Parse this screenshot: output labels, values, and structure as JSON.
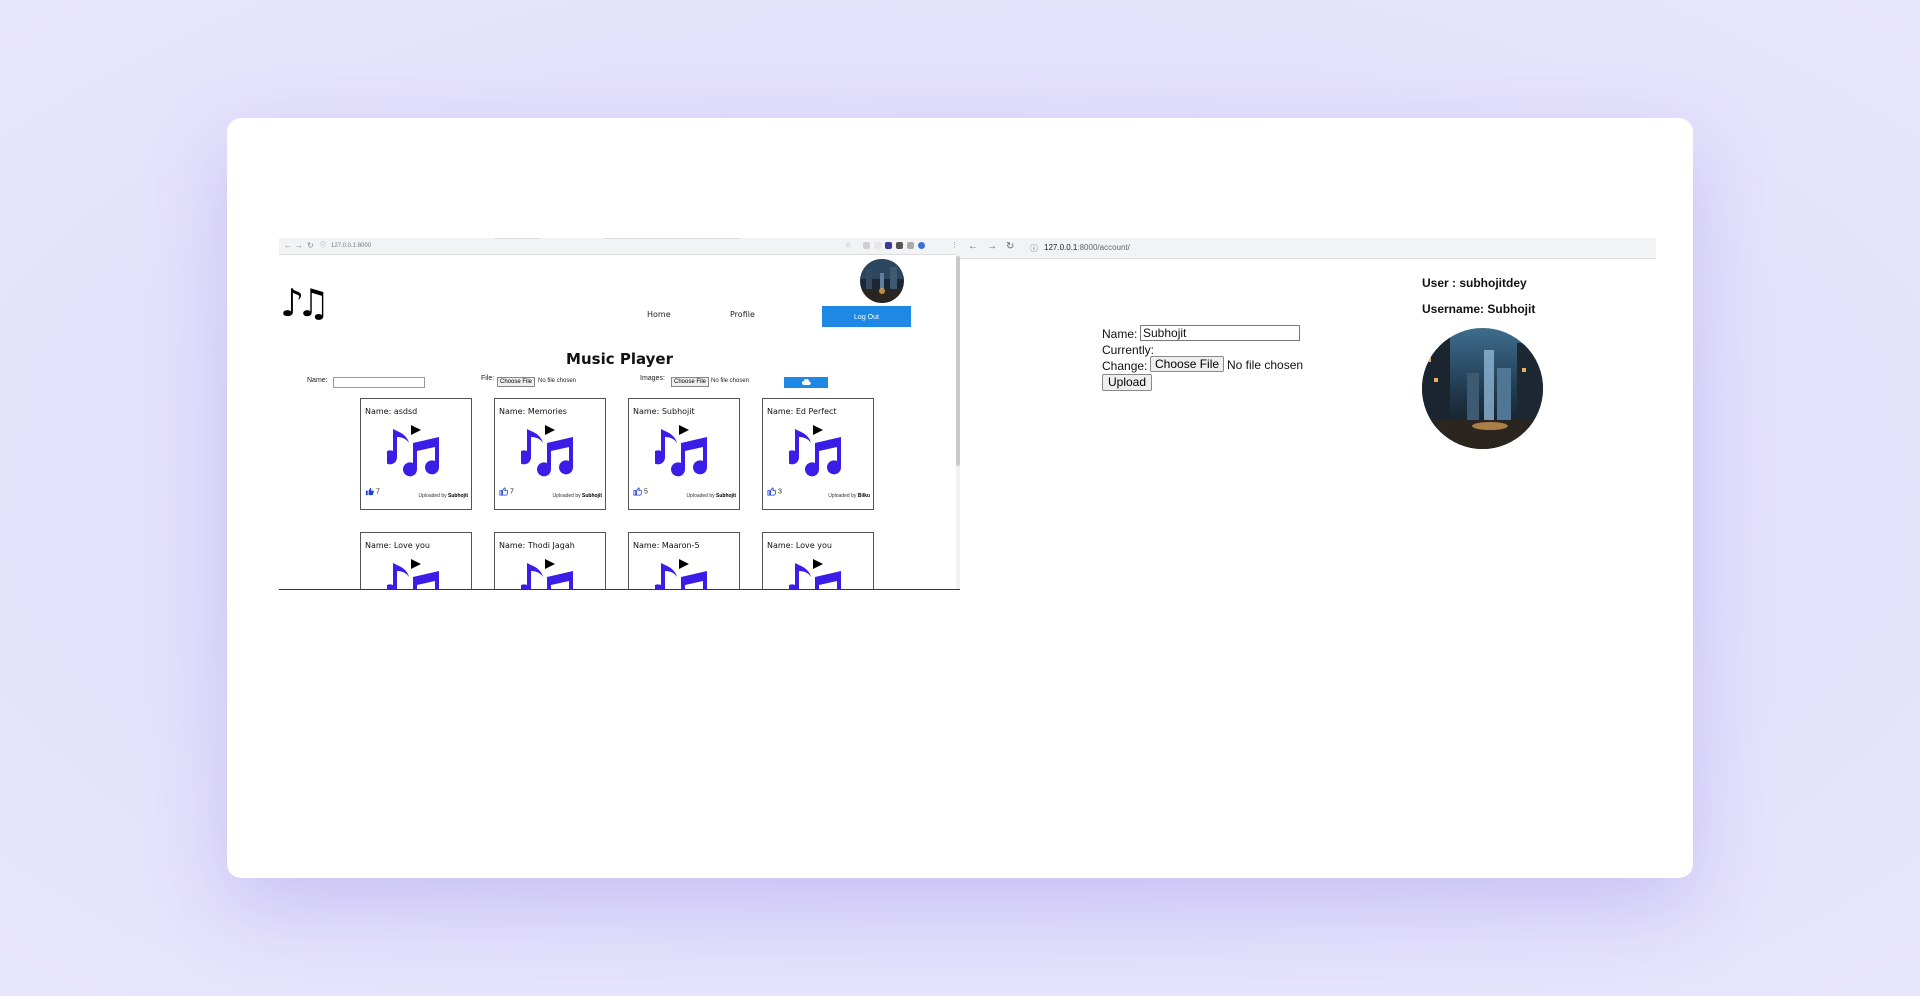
{
  "left_browser": {
    "url": "127.0.0.1:8000",
    "nav": {
      "home": "Home",
      "profile": "Profile",
      "logout": "Log Out"
    },
    "title": "Music Player",
    "form": {
      "name_label": "Name:",
      "file_label": "File:",
      "images_label": "Images:",
      "choose_file": "Choose File",
      "no_file": "No file chosen"
    },
    "songs": [
      {
        "name": "Name: asdsd",
        "likes": "7",
        "uploaded_by": "Uploaded by",
        "uploader": "Subhojit",
        "liked": true
      },
      {
        "name": "Name: Memories",
        "likes": "7",
        "uploaded_by": "Uploaded by",
        "uploader": "Subhojit",
        "liked": false
      },
      {
        "name": "Name: Subhojit",
        "likes": "5",
        "uploaded_by": "Uploaded by",
        "uploader": "Subhojit",
        "liked": false
      },
      {
        "name": "Name: Ed Perfect",
        "likes": "3",
        "uploaded_by": "Uploaded by",
        "uploader": "Bilku",
        "liked": false
      },
      {
        "name": "Name: Love you"
      },
      {
        "name": "Name: Thodi Jagah"
      },
      {
        "name": "Name: Maaron-5"
      },
      {
        "name": "Name: Love you"
      }
    ],
    "colors": {
      "accent": "#1e88e5",
      "note": "#3a1ee8"
    }
  },
  "right_browser": {
    "url_host": "127.0.0.1",
    "url_rest": ":8000/account/",
    "user": "User : subhojitdey",
    "username": "Username: Subhojit",
    "name_label": "Name:",
    "name_value": "Subhojit",
    "currently_label": "Currently:",
    "change_label": "Change:",
    "choose_file": "Choose File",
    "no_file": "No file chosen",
    "upload": "Upload"
  }
}
